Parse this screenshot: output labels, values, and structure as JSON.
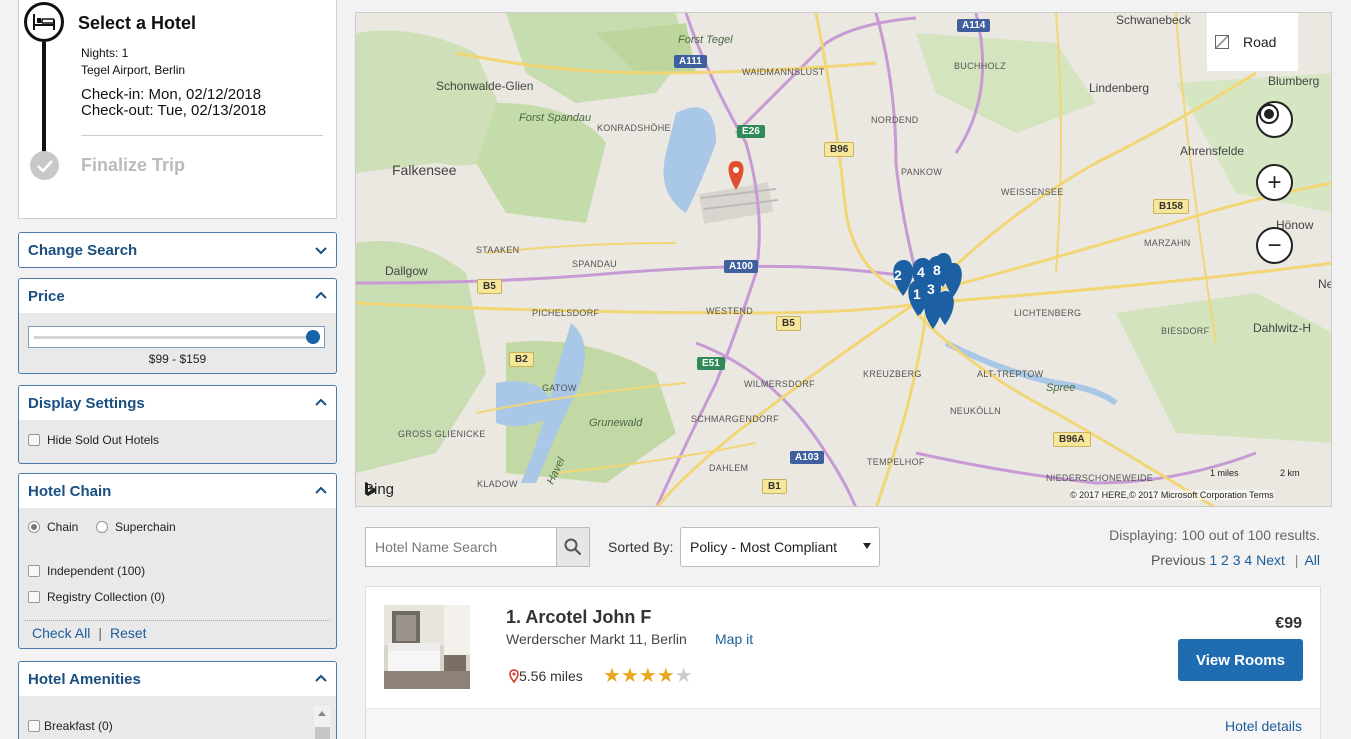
{
  "trip": {
    "title": "Select a Hotel",
    "nights": "Nights: 1",
    "location": "Tegel Airport, Berlin",
    "checkin": "Check-in: Mon, 02/12/2018",
    "checkout": "Check-out: Tue, 02/13/2018",
    "finalize": "Finalize Trip"
  },
  "filters": {
    "change_search": "Change Search",
    "price": {
      "title": "Price",
      "range": "$99 - $159",
      "level": 1.0
    },
    "display": {
      "title": "Display Settings",
      "hide_sold_out": "Hide Sold Out Hotels"
    },
    "chain": {
      "title": "Hotel Chain",
      "radio_chain": "Chain",
      "radio_superchain": "Superchain",
      "independent": "Independent (100)",
      "registry": "Registry Collection (0)",
      "check_all": "Check All",
      "separator": "|",
      "reset": "Reset"
    },
    "amenities": {
      "title": "Hotel Amenities",
      "breakfast": "Breakfast (0)"
    }
  },
  "map": {
    "labels": {
      "forst_tegel": "Forst Tegel",
      "schwanebeck": "Schwanebeck",
      "blumberg": "Blumberg",
      "schonwalde": "Schonwalde-Glien",
      "waidmannslust": "WAIDMANNSLUST",
      "buchholz": "BUCHHOLZ",
      "lindenberg": "Lindenberg",
      "forst_spandau": "Forst Spandau",
      "konradshohe": "KONRADSHÖHE",
      "nordend": "NORDEND",
      "ahrensfelde": "Ahrensfelde",
      "falkensee": "Falkensee",
      "pankow": "PANKOW",
      "weissensee": "WEISSENSEE",
      "honow": "Hönow",
      "staaken": "STAAKEN",
      "spandau": "SPANDAU",
      "marzahn": "MARZAHN",
      "dallgow": "Dallgow",
      "ne": "Ne",
      "pichelsdorf": "PICHELSDORF",
      "westend": "WESTEND",
      "lichtenberg": "LICHTENBERG",
      "biesdorf": "BIESDORF",
      "dahlwitz": "Dahlwitz-H",
      "gatow": "GATOW",
      "wilmersdorf": "WILMERSDORF",
      "kreuzberg": "KREUZBERG",
      "alt_treptow": "ALT-TREPTOW",
      "spree": "Spree",
      "grunewald": "Grunewald",
      "schmargendorf": "SCHMARGENDORF",
      "neukolln": "NEUKÖLLN",
      "gross_glienicke": "GROSS GLIENICKE",
      "havel": "Havel",
      "dahlem": "DAHLEM",
      "tempelhof": "TEMPELHOF",
      "kladow": "KLADOW",
      "niederschoneweide": "NIEDERSCHONEWEIDE"
    },
    "shields": {
      "a111": "A111",
      "a114": "A114",
      "e26": "E26",
      "b96": "B96",
      "b158": "B158",
      "a100": "A100",
      "b5a": "B5",
      "b5b": "B5",
      "b2": "B2",
      "e51": "E51",
      "a103": "A103",
      "b96a": "B96A",
      "b1": "B1"
    },
    "pins": [
      "2",
      "4",
      "8",
      "1",
      "3"
    ],
    "road_label": "Road",
    "zoom_in": "+",
    "zoom_out": "−",
    "bing": "Bing",
    "scale_miles": "1 miles",
    "scale_km": "2 km",
    "copyright": "© 2017 HERE,© 2017 Microsoft Corporation  Terms"
  },
  "results": {
    "search_placeholder": "Hotel Name Search",
    "sorted_by": "Sorted By:",
    "sort_value": "Policy - Most Compliant",
    "displaying": "Displaying: 100 out of 100 results.",
    "pager": {
      "previous": "Previous",
      "p1": "1",
      "p2": "2",
      "p3": "3",
      "p4": "4",
      "next": "Next",
      "sep": "|",
      "all": "All"
    }
  },
  "hotel": {
    "name": "1. Arcotel John F",
    "address": "Werderscher Markt 11, Berlin",
    "map_link": "Map it",
    "distance": "5.56 miles",
    "rating": 4,
    "rating_max": 5,
    "price": "€99",
    "view_rooms": "View Rooms",
    "details": "Hotel details"
  },
  "colors": {
    "accent": "#1f6db0",
    "panel_header": "#1a4f80",
    "link": "#1a5d99",
    "star": "#e8a820",
    "map_pin": "#1d5fa3",
    "airport_marker": "#e0502e"
  }
}
